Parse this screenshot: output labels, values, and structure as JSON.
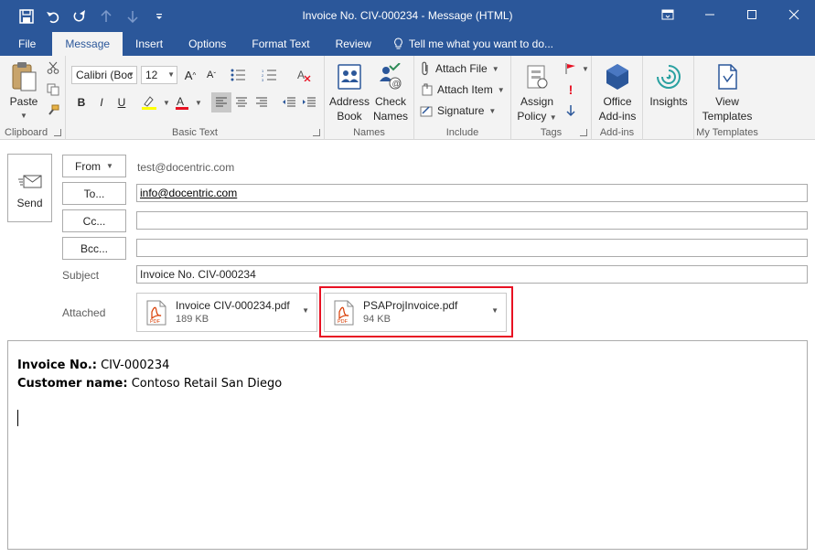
{
  "window": {
    "title": "Invoice No. CIV-000234 - Message (HTML)"
  },
  "quick_access": [
    "save-icon",
    "undo-icon",
    "redo-icon",
    "up-icon",
    "down-icon",
    "customize-icon"
  ],
  "tabs": [
    {
      "label": "File",
      "active": false
    },
    {
      "label": "Message",
      "active": true
    },
    {
      "label": "Insert",
      "active": false
    },
    {
      "label": "Options",
      "active": false
    },
    {
      "label": "Format Text",
      "active": false
    },
    {
      "label": "Review",
      "active": false
    }
  ],
  "tellme": "Tell me what you want to do...",
  "ribbon": {
    "clipboard": {
      "label": "Clipboard",
      "paste": "Paste"
    },
    "basic_text": {
      "label": "Basic Text",
      "font": "Calibri (Boc",
      "size": "12",
      "bold": "B",
      "italic": "I",
      "underline": "U"
    },
    "names": {
      "label": "Names",
      "address_book": [
        "Address",
        "Book"
      ],
      "check_names": [
        "Check",
        "Names"
      ]
    },
    "include": {
      "label": "Include",
      "attach_file": "Attach File",
      "attach_item": "Attach Item",
      "signature": "Signature"
    },
    "tags": {
      "label": "Tags",
      "assign_policy": [
        "Assign",
        "Policy"
      ]
    },
    "addins": {
      "label": "Add-ins",
      "office_addins": [
        "Office",
        "Add-ins"
      ]
    },
    "insights": {
      "label": "Insights"
    },
    "my_templates": {
      "label": "My Templates",
      "view_templates": [
        "View",
        "Templates"
      ]
    }
  },
  "compose": {
    "send": "Send",
    "from_label": "From",
    "from_value": "test@docentric.com",
    "to_label": "To...",
    "to_value": "info@docentric.com",
    "cc_label": "Cc...",
    "cc_value": "",
    "bcc_label": "Bcc...",
    "bcc_value": "",
    "subject_label": "Subject",
    "subject_value": "Invoice No. CIV-000234",
    "attached_label": "Attached",
    "attachments": [
      {
        "name": "Invoice CIV-000234.pdf",
        "size": "189 KB",
        "icon": "pdf-icon",
        "highlighted": false
      },
      {
        "name": "PSAProjInvoice.pdf",
        "size": "94 KB",
        "icon": "pdf-icon",
        "highlighted": true
      }
    ]
  },
  "body": {
    "line1_label": "Invoice No.:",
    "line1_value": " CIV-000234",
    "line2_label": "Customer name:",
    "line2_value": " Contoso Retail San Diego"
  },
  "colors": {
    "accent": "#2b579a",
    "highlight": "#e81123",
    "pdf": "#d83b01"
  }
}
